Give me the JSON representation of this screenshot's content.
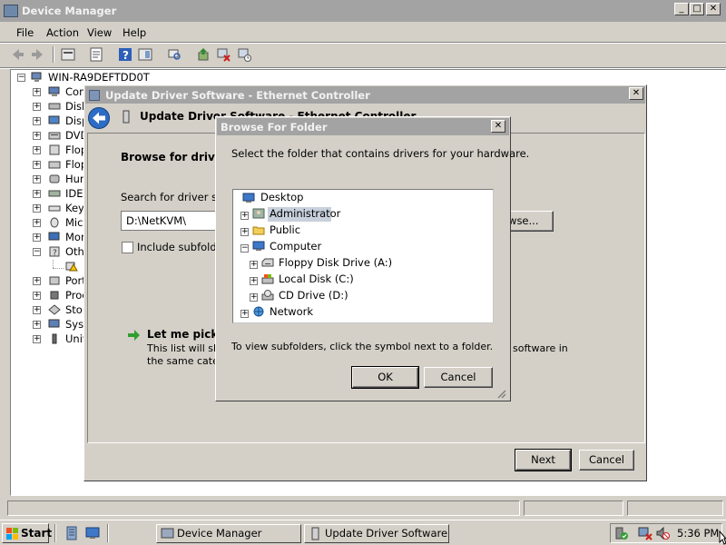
{
  "device_manager": {
    "title": "Device Manager",
    "menu": [
      "File",
      "Action",
      "View",
      "Help"
    ],
    "root": "WIN-RA9DEFTDD0T",
    "categories": [
      "Com",
      "Disk",
      "Disp",
      "DVD",
      "Flop",
      "Flop",
      "Hum",
      "IDE",
      "Key",
      "Mice",
      "Mon",
      "Oth",
      "",
      "Port",
      "Proc",
      "Stor",
      "Syst",
      "Univ"
    ]
  },
  "update_driver": {
    "title": "Update Driver Software - Ethernet Controller",
    "header": "Update Driver Software - Ethernet Controller",
    "browse_heading": "Browse for driver s",
    "search_label": "Search for driver sof",
    "path_value": "D:\\NetKVM\\",
    "browse_button": "owse...",
    "include_subfolders": "Include subfolde",
    "let_me_pick": "Let me pick fr",
    "pick_desc_line1": "This list will show",
    "pick_desc_line2": "the same categ",
    "pick_desc_tail": "software in",
    "next_button": "Next",
    "cancel_button": "Cancel"
  },
  "browse_folder": {
    "title": "Browse For Folder",
    "instruction": "Select the folder that contains drivers for your hardware.",
    "tree": [
      {
        "label": "Desktop",
        "icon": "desktop-icon"
      },
      {
        "label": "Administrator",
        "icon": "user-folder-icon"
      },
      {
        "label": "Public",
        "icon": "folder-icon"
      },
      {
        "label": "Computer",
        "icon": "computer-icon"
      },
      {
        "label": "Floppy Disk Drive (A:)",
        "icon": "floppy-drive-icon"
      },
      {
        "label": "Local Disk (C:)",
        "icon": "hard-disk-icon"
      },
      {
        "label": "CD Drive (D:)",
        "icon": "cd-drive-icon"
      },
      {
        "label": "Network",
        "icon": "network-icon"
      }
    ],
    "hint": "To view subfolders, click the symbol next to a folder.",
    "ok_button": "OK",
    "cancel_button": "Cancel"
  },
  "taskbar": {
    "start": "Start",
    "tasks": [
      "Device Manager",
      "Update Driver Software ..."
    ],
    "clock": "5:36 PM"
  },
  "colors": {
    "desktop_gray": "#d4d0c8",
    "title_inactive": "#a3a3a3",
    "selection": "#c8d0dc",
    "accent_blue": "#1e5fbf",
    "green_arrow": "#2f9e2f"
  }
}
